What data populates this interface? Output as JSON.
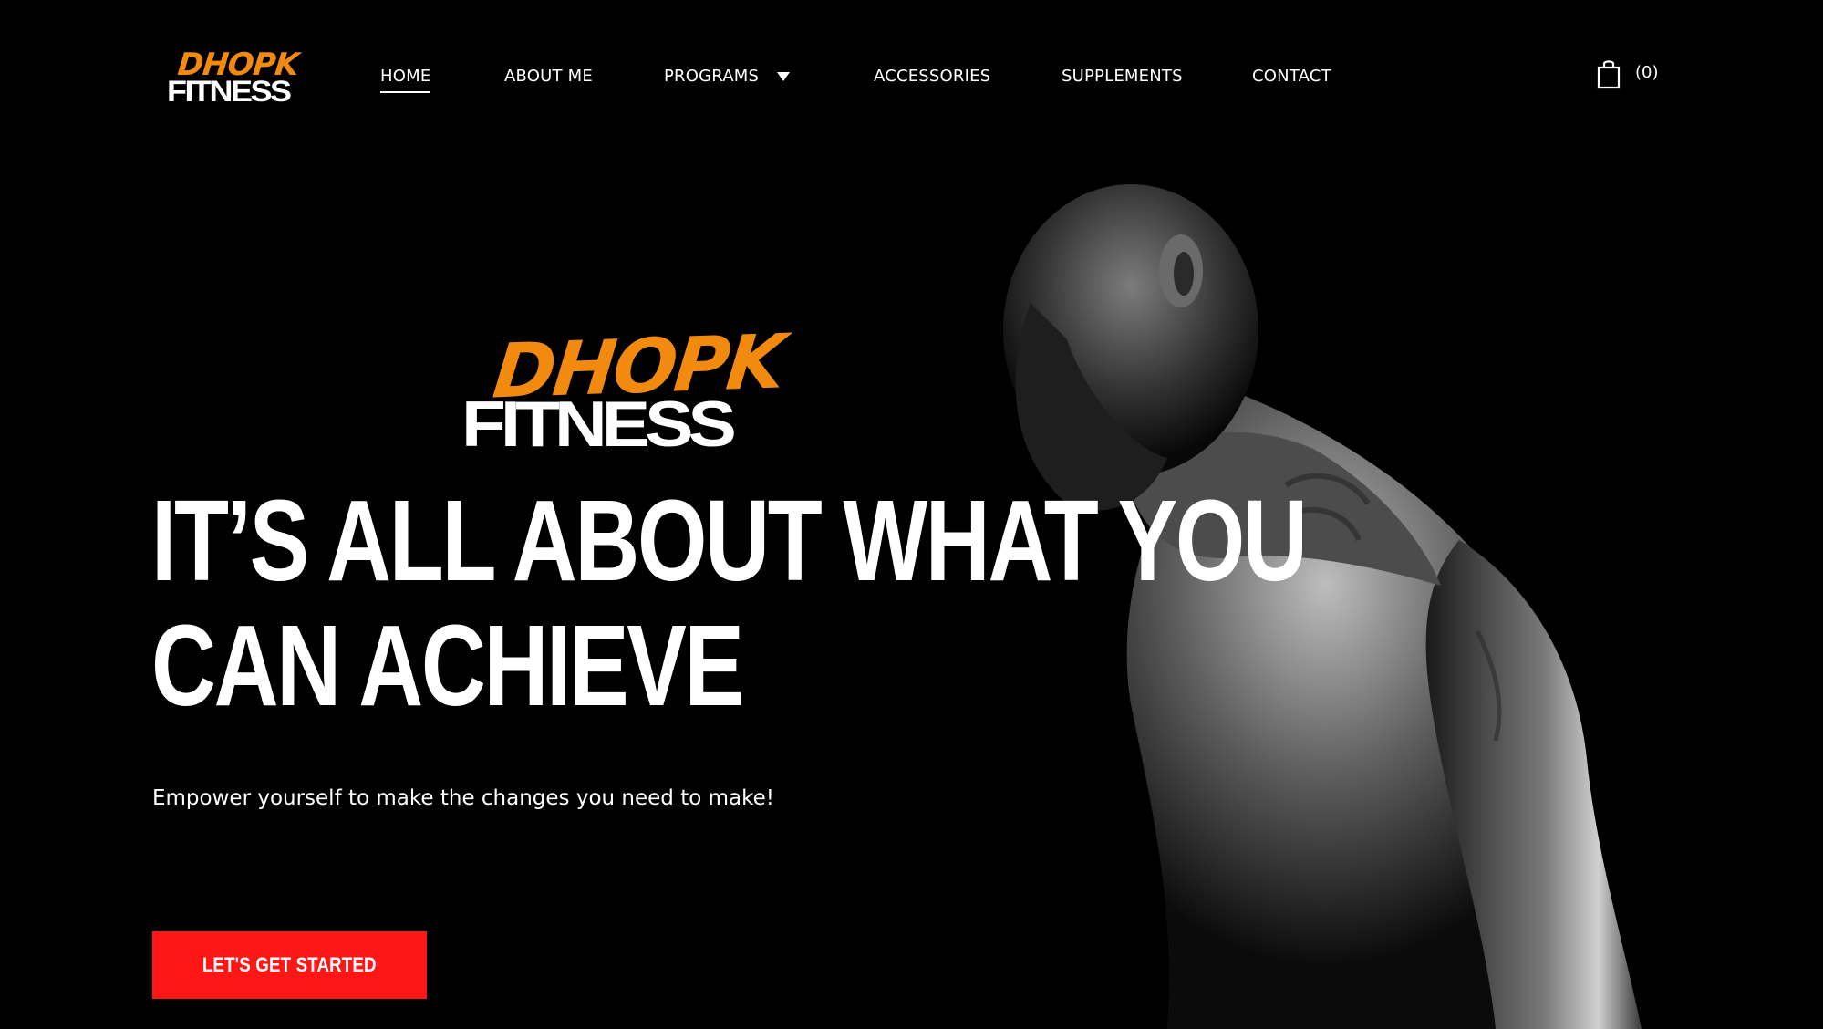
{
  "brand": {
    "logo_top": "DHOPK",
    "logo_bottom": "FITNESS"
  },
  "nav": {
    "items": [
      {
        "label": "HOME",
        "active": true
      },
      {
        "label": "ABOUT ME",
        "active": false
      },
      {
        "label": "PROGRAMS",
        "active": false,
        "has_dropdown": true
      },
      {
        "label": "ACCESSORIES",
        "active": false
      },
      {
        "label": "SUPPLEMENTS",
        "active": false
      },
      {
        "label": "CONTACT",
        "active": false
      }
    ]
  },
  "cart": {
    "icon": "shopping-bag-icon",
    "count_label": "(0)"
  },
  "hero": {
    "logo_top": "DHOPK",
    "logo_bottom": "FITNESS",
    "headline_line1": "IT’S ALL ABOUT WHAT YOU",
    "headline_line2": "CAN ACHIEVE",
    "subtext": "Empower yourself to make the changes you need to make!",
    "cta_label": "LET'S GET STARTED",
    "image": "muscular-man-portrait"
  },
  "colors": {
    "background": "#000000",
    "accent_orange": "#f28a0f",
    "cta_red": "#ff1616",
    "text": "#ffffff"
  }
}
